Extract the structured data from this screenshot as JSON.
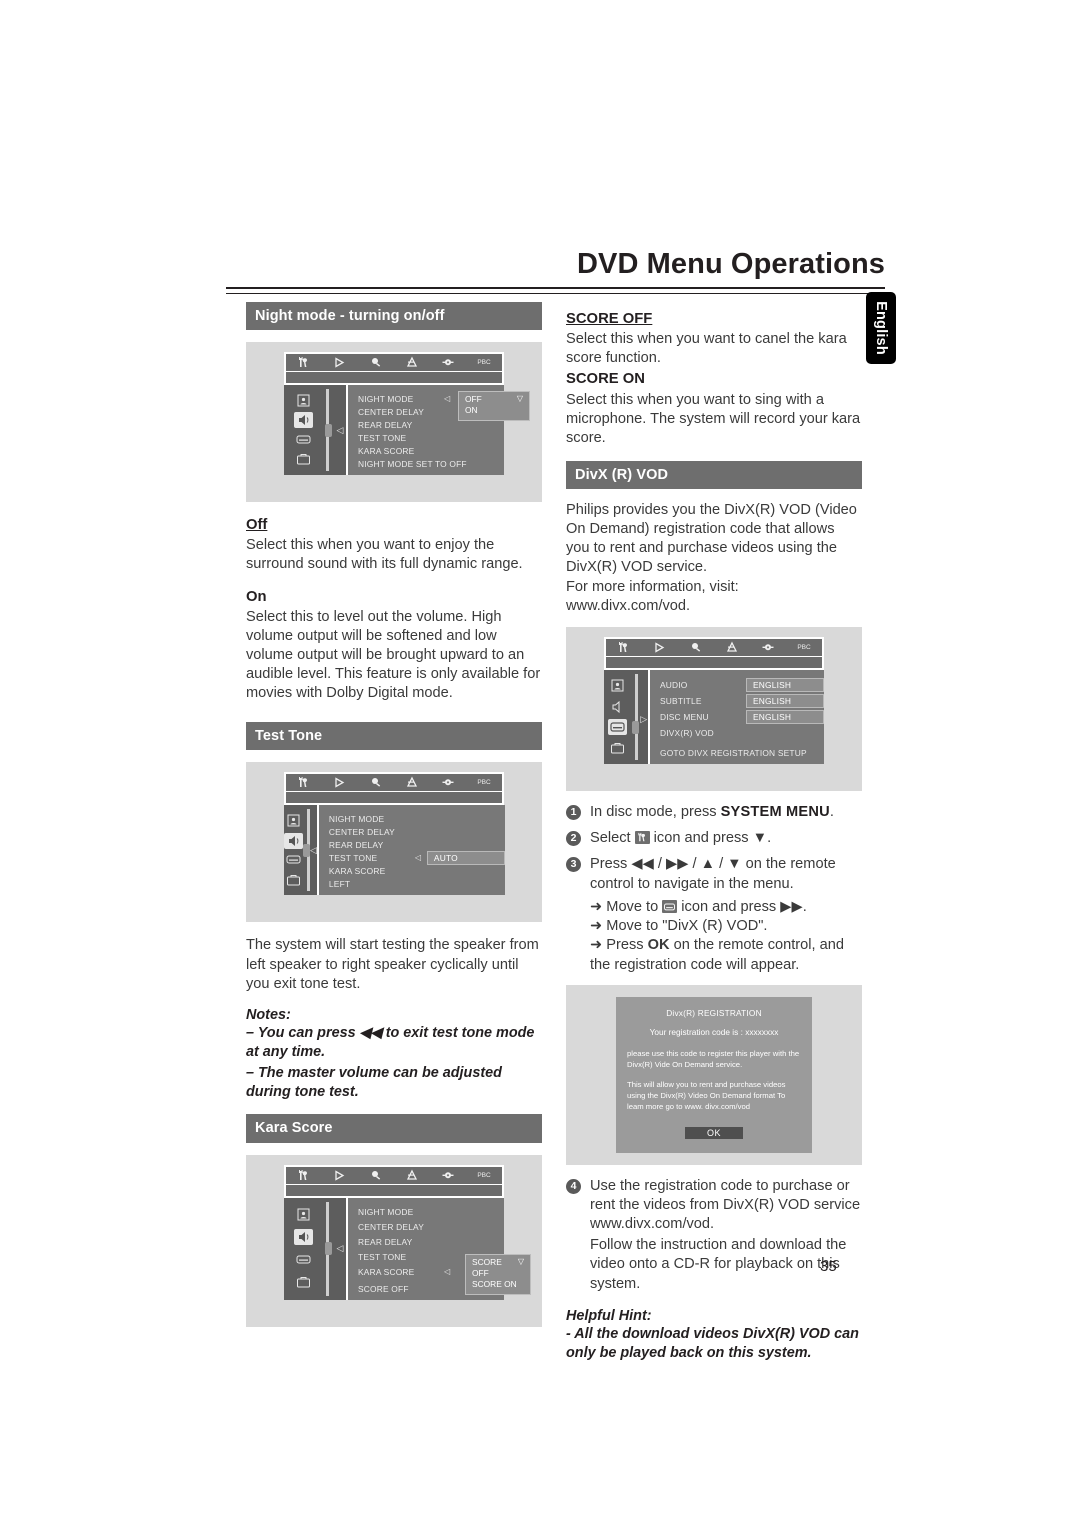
{
  "header": {
    "title": "DVD Menu Operations",
    "language_tab": "English",
    "page_number": "35"
  },
  "left_column": {
    "night_mode": {
      "heading": "Night mode - turning on/off",
      "osd": {
        "icon_bar": [
          "tools-icon",
          "play-icon",
          "sound-icon",
          "preference-icon",
          "display-icon",
          "pbc-label"
        ],
        "pbc_label": "PBC",
        "sidebar_icons": [
          "general-setup-icon",
          "audio-setup-icon",
          "video-setup-icon",
          "preference-setup-icon"
        ],
        "selected_sidebar_index": 1,
        "rows": [
          "NIGHT MODE",
          "CENTER DELAY",
          "REAR DELAY",
          "TEST TONE",
          "KARA SCORE"
        ],
        "popup_options": [
          "OFF",
          "ON"
        ],
        "status": "NIGHT MODE SET TO OFF"
      },
      "off_label": "Off",
      "off_text": "Select this when you want to enjoy the surround sound with its full dynamic range.",
      "on_label": "On",
      "on_text": "Select this to level out the volume. High volume output will be softened and low volume output will be brought upward to an audible level. This feature is only available for movies with Dolby Digital mode."
    },
    "test_tone": {
      "heading": "Test Tone",
      "osd": {
        "pbc_label": "PBC",
        "rows": [
          "NIGHT MODE",
          "CENTER DELAY",
          "REAR DELAY",
          "TEST TONE",
          "KARA SCORE"
        ],
        "value": "AUTO",
        "value_row_index": 3,
        "status": "LEFT"
      },
      "text": "The system will start testing the speaker from left speaker to right speaker cyclically until you exit tone test.",
      "notes_label": "Notes:",
      "notes": [
        "– You can press ◀◀ to exit test tone mode at any time.",
        "– The master volume can be adjusted during tone test."
      ]
    },
    "kara_score": {
      "heading": "Kara Score",
      "osd": {
        "pbc_label": "PBC",
        "rows": [
          "NIGHT MODE",
          "CENTER DELAY",
          "REAR DELAY",
          "TEST TONE",
          "KARA SCORE"
        ],
        "popup_options": [
          "SCORE OFF",
          "SCORE ON"
        ],
        "status": "SCORE OFF"
      }
    }
  },
  "right_column": {
    "score_off_label": "SCORE OFF",
    "score_off_text": "Select this when you want to canel the kara score function.",
    "score_on_label": "SCORE ON",
    "score_on_text": "Select this when you want to sing with a microphone. The system will record your kara score.",
    "divx": {
      "heading": "DivX (R) VOD",
      "intro": "Philips provides you the DivX(R) VOD (Video On Demand) registration code that allows you to rent and purchase videos using the DivX(R) VOD service.",
      "more_info": "For more information, visit:",
      "url": "www.divx.com/vod.",
      "osd": {
        "pbc_label": "PBC",
        "rows": [
          {
            "label": "AUDIO",
            "value": "ENGLISH"
          },
          {
            "label": "SUBTITLE",
            "value": "ENGLISH"
          },
          {
            "label": "DISC MENU",
            "value": "ENGLISH"
          },
          {
            "label": "DIVX(R) VOD",
            "value": ""
          }
        ],
        "status": "GOTO  DIVX REGISTRATION SETUP"
      },
      "steps": [
        {
          "num": "1",
          "text_before": "In disc mode, press ",
          "bold": "SYSTEM MENU",
          "text_after": "."
        },
        {
          "num": "2",
          "text_before": "Select ",
          "icon": "tools-icon",
          "text_after": " icon and press ▼."
        },
        {
          "num": "3",
          "text_before": "Press ◀◀ / ▶▶ / ▲ / ▼ on the remote control to navigate in the menu."
        }
      ],
      "sub_steps": [
        {
          "prefix": "➜ Move to ",
          "icon": "video-setup-icon",
          "suffix": " icon and press ▶▶."
        },
        {
          "prefix": "➜ Move to \"DivX (R) VOD\"."
        },
        {
          "prefix": "➜ Press ",
          "bold": "OK",
          "suffix": " on the remote control, and the registration code will appear."
        }
      ],
      "dialog": {
        "title": "Divx(R) REGISTRATION",
        "code_line": "Your registration code is : xxxxxxxx",
        "para1": "please use this code to register this player with the Divx(R) Vide On Demand service.",
        "para2": "This will allow you to rent and purchase videos using the Divx(R) Video On Demand format To leam more go to www. divx.com/vod",
        "ok_label": "OK"
      },
      "step4": {
        "num": "4",
        "text1": "Use the registration code to purchase or rent the videos from DivX(R) VOD service www.divx.com/vod.",
        "text2": "Follow the instruction and download the video onto a CD-R for playback on this system."
      },
      "hint_label": "Helpful Hint:",
      "hint_text": "- All the download videos DivX(R) VOD can only be played back on this system."
    }
  },
  "colors": {
    "section_bar": "#6e6e6e",
    "osd_bg": "#d9d9d9",
    "osd_main": "#787878",
    "osd_side": "#5d5d5d",
    "text": "#3a3a3a"
  }
}
